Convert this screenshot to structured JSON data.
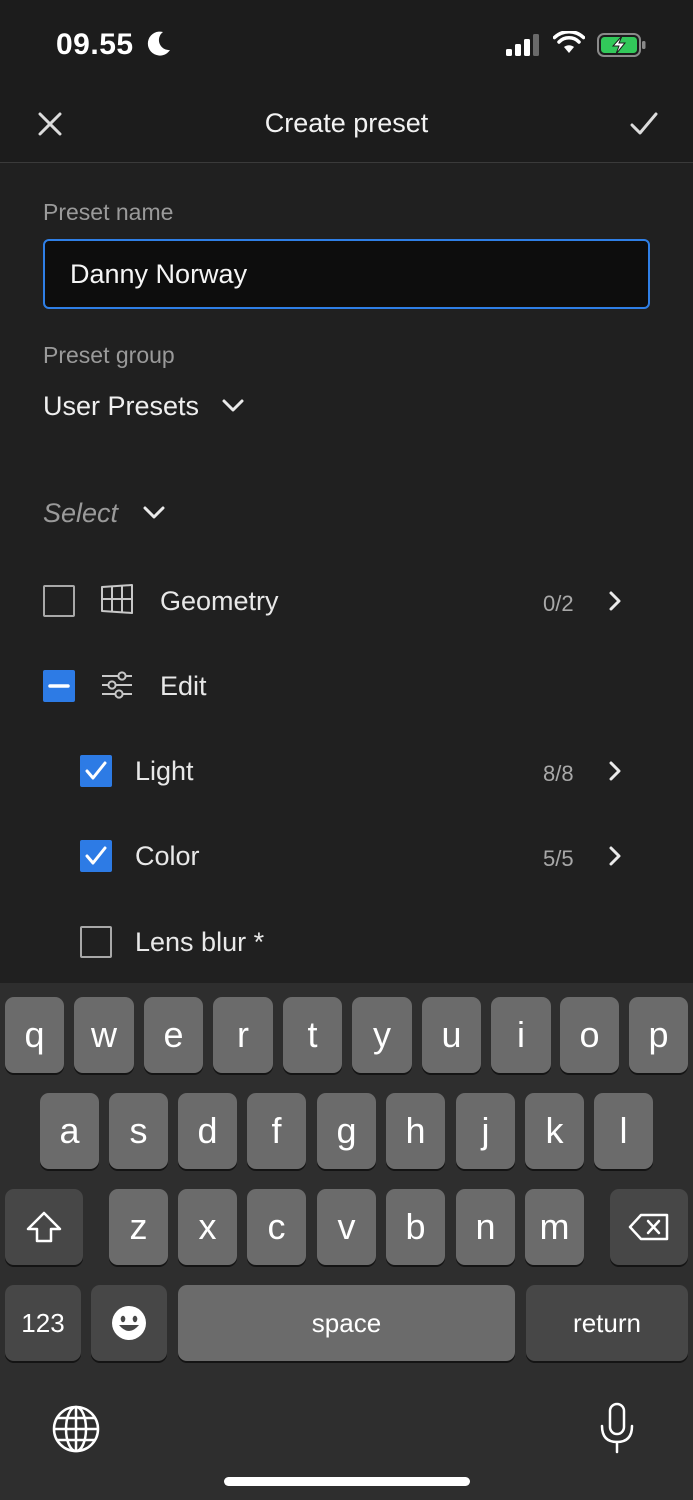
{
  "status_bar": {
    "time": "09.55"
  },
  "header": {
    "title": "Create preset"
  },
  "form": {
    "name_label": "Preset name",
    "name_value": "Danny Norway",
    "group_label": "Preset group",
    "group_value": "User Presets",
    "select_label": "Select"
  },
  "items": [
    {
      "label": "Geometry",
      "count": "0/2",
      "state": "unchecked"
    },
    {
      "label": "Edit",
      "count": "",
      "state": "partial"
    },
    {
      "label": "Light",
      "count": "8/8",
      "state": "checked"
    },
    {
      "label": "Color",
      "count": "5/5",
      "state": "checked"
    },
    {
      "label": "Lens blur *",
      "count": "",
      "state": "unchecked"
    }
  ],
  "keyboard": {
    "row1": [
      "q",
      "w",
      "e",
      "r",
      "t",
      "y",
      "u",
      "i",
      "o",
      "p"
    ],
    "row2": [
      "a",
      "s",
      "d",
      "f",
      "g",
      "h",
      "j",
      "k",
      "l"
    ],
    "row3": [
      "z",
      "x",
      "c",
      "v",
      "b",
      "n",
      "m"
    ],
    "numbers_key": "123",
    "space_key": "space",
    "return_key": "return"
  },
  "colors": {
    "accent": "#2d7be5",
    "background": "#202020",
    "key": "#6b6b6b",
    "key_dark": "#474747"
  },
  "icons": {
    "close": "close-icon",
    "confirm": "checkmark-icon",
    "geometry": "geometry-grid-icon",
    "edit": "sliders-icon",
    "shift": "shift-icon",
    "backspace": "backspace-icon",
    "emoji": "emoji-icon",
    "globe": "globe-icon",
    "mic": "microphone-icon"
  }
}
